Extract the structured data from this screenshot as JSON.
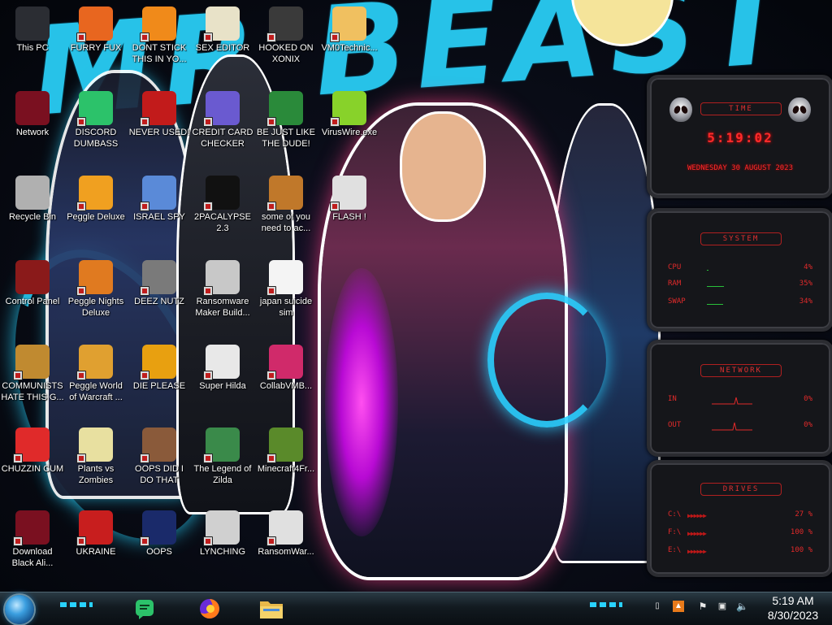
{
  "wallpaper": {
    "title": "MR BEAST",
    "accent": "#27c2e8"
  },
  "desktop_icons": [
    {
      "label": "This PC",
      "icon": "computer-icon",
      "color": "#2b2d33"
    },
    {
      "label": "FURRY FUX",
      "icon": "firefox-icon",
      "color": "#e8661f"
    },
    {
      "label": "DONT STICK THIS IN YO...",
      "icon": "vlc-cone-icon",
      "color": "#f08a1a"
    },
    {
      "label": "SEX EDITOR",
      "icon": "hex-editor-icon",
      "color": "#e8e2c8"
    },
    {
      "label": "HOOKED ON XONIX",
      "icon": "xonix-icon",
      "color": "#3a3a3a"
    },
    {
      "label": "VM0Technic...",
      "icon": "doctor-icon",
      "color": "#f0c060"
    },
    {
      "label": "Network",
      "icon": "network-orb-icon",
      "color": "#7a1020"
    },
    {
      "label": "DISCORD DUMBASS",
      "icon": "green-chat-icon",
      "color": "#2cc26a"
    },
    {
      "label": "NEVER USED!",
      "icon": "dev-cpp-icon",
      "color": "#c21b1b"
    },
    {
      "label": "CREDIT CARD CHECKER",
      "icon": "credit-card-icon",
      "color": "#6a5ad0"
    },
    {
      "label": "BE JUST LIKE THE DUDE!",
      "icon": "santa-icon",
      "color": "#2a8a3a"
    },
    {
      "label": "VirusWire.exe",
      "icon": "lime-icon",
      "color": "#88d22a"
    },
    {
      "label": "Recycle Bin",
      "icon": "recycle-bin-icon",
      "color": "#b0b0b0"
    },
    {
      "label": "Peggle Deluxe",
      "icon": "peggle-icon",
      "color": "#f0a020"
    },
    {
      "label": "ISRAEL SPY",
      "icon": "spy-window-icon",
      "color": "#5a8ad8"
    },
    {
      "label": "2PACALYPSE 2.3",
      "icon": "terminal-icon",
      "color": "#111111"
    },
    {
      "label": "some of you need to ac...",
      "icon": "beaver-icon",
      "color": "#c0782a"
    },
    {
      "label": "FLASH !",
      "icon": "flash-page-icon",
      "color": "#e0e0e0"
    },
    {
      "label": "Control Panel",
      "icon": "control-panel-icon",
      "color": "#8a1a1a"
    },
    {
      "label": "Peggle Nights Deluxe",
      "icon": "peggle-nights-icon",
      "color": "#e07a20"
    },
    {
      "label": "DEEZ NUTZ",
      "icon": "stacked-windows-icon",
      "color": "#7a7a7a"
    },
    {
      "label": "Ransomware Maker Build...",
      "icon": "window-app-icon",
      "color": "#c8c8c8"
    },
    {
      "label": "japan suicide sim",
      "icon": "document-icon",
      "color": "#f4f4f4"
    },
    {
      "label": "COMMUNISTS HATE THIS G...",
      "icon": "money-bag-icon",
      "color": "#c08a30"
    },
    {
      "label": "Peggle World of Warcraft ...",
      "icon": "peggle-wow-icon",
      "color": "#e0a030"
    },
    {
      "label": "DIE PLEASE",
      "icon": "de-icon",
      "color": "#e8a010"
    },
    {
      "label": "Super Hilda",
      "icon": "pixel-cat-icon",
      "color": "#e8e8e8"
    },
    {
      "label": "CollabVMB...",
      "icon": "monitor-icon",
      "color": "#d02a6a"
    },
    {
      "label": "CHUZZIN CUM",
      "icon": "chuzzle-icon",
      "color": "#e02a2a"
    },
    {
      "label": "Plants vs Zombies",
      "icon": "flower-icon",
      "color": "#e8e0a0"
    },
    {
      "label": "OOPS DID I DO THAT",
      "icon": "portrait-icon",
      "color": "#8a5a3a"
    },
    {
      "label": "The Legend of Zilda",
      "icon": "zelda-icon",
      "color": "#3a8a4a"
    },
    {
      "label": "Minecraft4Fr...",
      "icon": "grass-block-icon",
      "color": "#5a8a2a"
    },
    {
      "label": "Download Black Ali...",
      "icon": "alien-orb-icon",
      "color": "#7a1020"
    },
    {
      "label": "UKRAINE",
      "icon": "radiation-icon",
      "color": "#c81e1e"
    },
    {
      "label": "OOPS",
      "icon": "bsod-icon",
      "color": "#1a2a6a"
    },
    {
      "label": "LYNCHING",
      "icon": "knot-icon",
      "color": "#d0d0d0"
    },
    {
      "label": "RansomWar...",
      "icon": "skull-icon",
      "color": "#e0e0e0"
    }
  ],
  "widgets": {
    "time": {
      "heading": "TIME",
      "clock": "5:19:02",
      "date": "WEDNESDAY 30 AUGUST 2023"
    },
    "system": {
      "heading": "SYSTEM",
      "rows": [
        {
          "name": "CPU",
          "value": "4%",
          "level": 0.04
        },
        {
          "name": "RAM",
          "value": "35%",
          "level": 0.35
        },
        {
          "name": "SWAP",
          "value": "34%",
          "level": 0.34
        }
      ]
    },
    "network": {
      "heading": "NETWORK",
      "rows": [
        {
          "name": "IN",
          "value": "0%"
        },
        {
          "name": "OUT",
          "value": "0%"
        }
      ]
    },
    "drives": {
      "heading": "DRIVES",
      "rows": [
        {
          "name": "C:\\",
          "value": "27 %"
        },
        {
          "name": "F:\\",
          "value": "100 %"
        },
        {
          "name": "E:\\",
          "value": "100 %"
        }
      ]
    },
    "accent": "#e02a2a"
  },
  "taskbar": {
    "pinned": [
      {
        "name": "green-chat-app",
        "icon": "green-chat-icon"
      },
      {
        "name": "firefox",
        "icon": "firefox-icon"
      },
      {
        "name": "file-explorer",
        "icon": "folder-icon"
      }
    ],
    "tray": [
      "usb-icon",
      "fire-icon",
      "flag-icon",
      "network-icon",
      "volume-icon"
    ],
    "time": "5:19 AM",
    "date": "8/30/2023"
  }
}
